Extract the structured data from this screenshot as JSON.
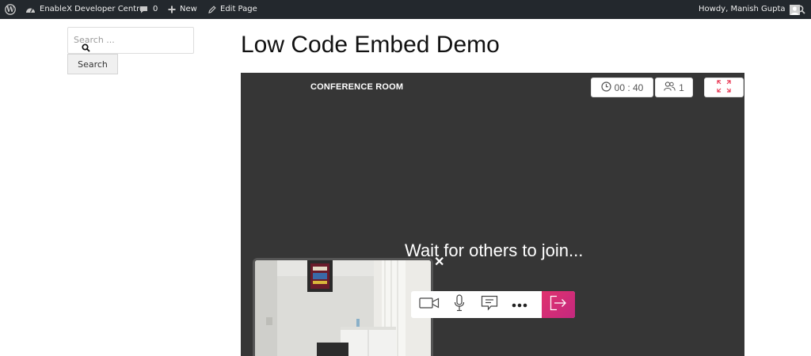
{
  "adminbar": {
    "site_name": "EnableX Developer Centre",
    "comments_count": "0",
    "new_label": "New",
    "edit_label": "Edit Page",
    "howdy": "Howdy, Manish Gupta"
  },
  "sidebar": {
    "search_placeholder": "Search ...",
    "search_button": "Search"
  },
  "page": {
    "title": "Low Code Embed Demo"
  },
  "conference": {
    "room_name": "CONFERENCE ROOM",
    "timer": "00 : 40",
    "participants": "1",
    "wait_message": "Wait for others to join...",
    "close_symbol": "✕",
    "toolbar": [
      "video-camera-icon",
      "microphone-icon",
      "chat-icon",
      "more-icon",
      "leave-icon"
    ],
    "leave_color": "#d82d74"
  }
}
